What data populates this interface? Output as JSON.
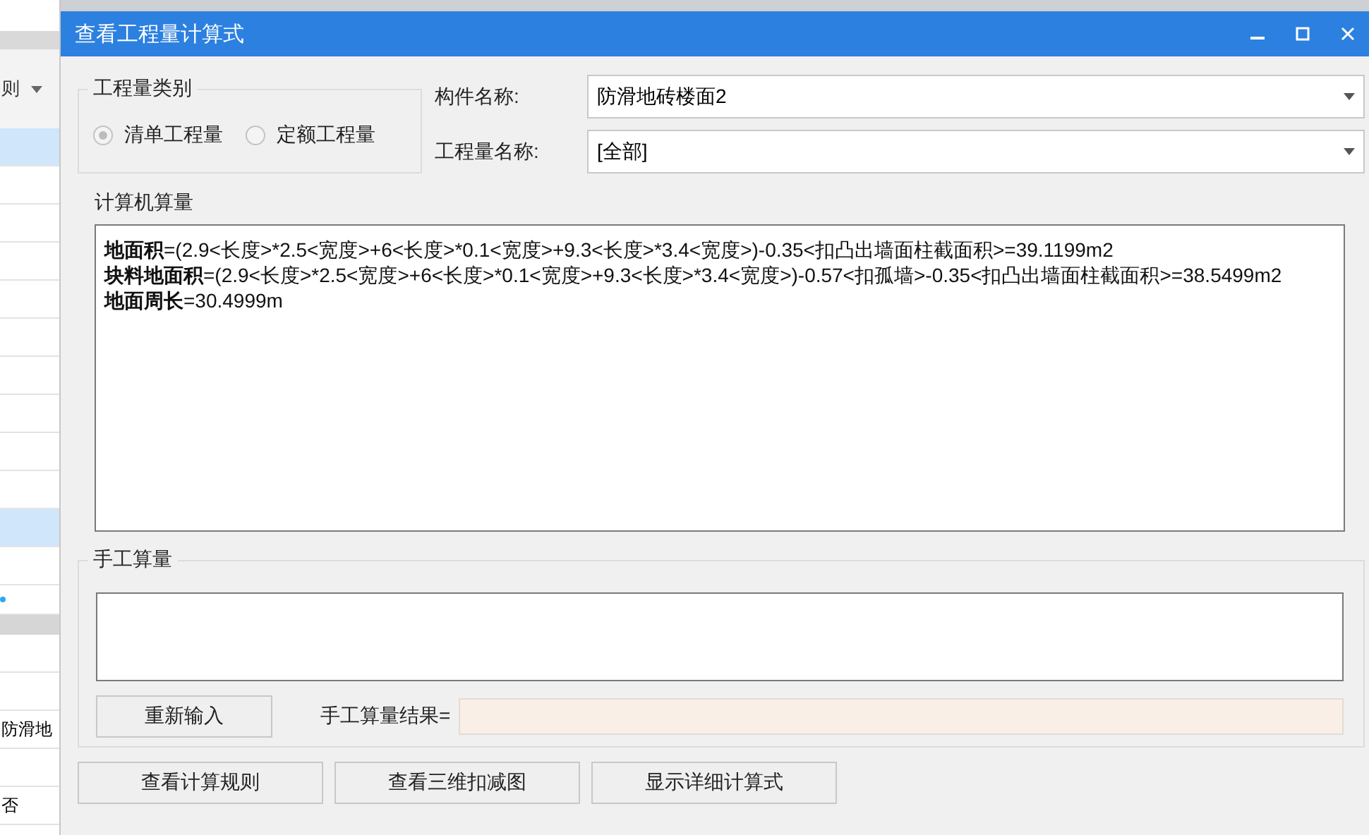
{
  "background_app": {
    "toolbar_label": "则",
    "rows": [
      {
        "selected": true
      },
      {
        "selected": false
      },
      {
        "selected": false
      },
      {
        "selected": false
      },
      {
        "selected": false
      },
      {
        "selected": false
      },
      {
        "selected": false
      },
      {
        "selected": false
      },
      {
        "selected": false
      },
      {
        "selected": false
      },
      {
        "selected": true
      },
      {
        "selected": false
      }
    ],
    "lower_rows": [
      {},
      {},
      {
        "text": "防滑地"
      },
      {},
      {
        "text": "否"
      }
    ]
  },
  "window": {
    "title": "查看工程量计算式"
  },
  "quantity_type": {
    "label": "工程量类别",
    "options": [
      {
        "label": "清单工程量",
        "selected": true
      },
      {
        "label": "定额工程量",
        "selected": false
      }
    ]
  },
  "fields": [
    {
      "label": "构件名称:",
      "value": "防滑地砖楼面2"
    },
    {
      "label": "工程量名称:",
      "value": "[全部]"
    }
  ],
  "computer": {
    "label": "计算机算量",
    "lines": [
      "**地面积**=(2.9<长度>*2.5<宽度>+6<长度>*0.1<宽度>+9.3<长度>*3.4<宽度>)-0.35<扣凸出墙面柱截面积>=39.1199m2",
      "**块料地面积**=(2.9<长度>*2.5<宽度>+6<长度>*0.1<宽度>+9.3<长度>*3.4<宽度>)-0.57<扣孤墙>-0.35<扣凸出墙面柱截面积>=38.5499m2",
      "**地面周长**=30.4999m"
    ]
  },
  "manual": {
    "label": "手工算量",
    "reset_button": "重新输入",
    "result_label": "手工算量结果="
  },
  "buttons": [
    "查看计算规则",
    "查看三维扣减图",
    "显示详细计算式"
  ]
}
